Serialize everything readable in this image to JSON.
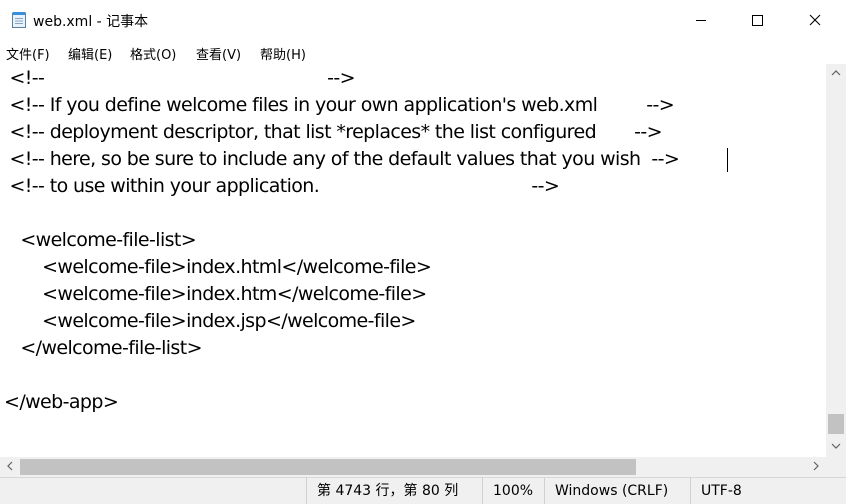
{
  "window": {
    "title": "web.xml - 记事本",
    "app_icon": "notepad-icon",
    "controls": {
      "minimize": "minimize-icon",
      "maximize": "maximize-icon",
      "close": "close-icon"
    }
  },
  "menu": {
    "items": [
      "文件(F)",
      "编辑(E)",
      "格式(O)",
      "查看(V)",
      "帮助(H)"
    ]
  },
  "editor": {
    "lines": [
      " <!--                                                    -->",
      " <!-- If you define welcome files in your own application's web.xml         -->",
      " <!-- deployment descriptor, that list *replaces* the list configured       -->",
      " <!-- here, so be sure to include any of the default values that you wish  -->",
      " <!-- to use within your application.                                       -->",
      "",
      "   <welcome-file-list>",
      "       <welcome-file>index.html</welcome-file>",
      "       <welcome-file>index.htm</welcome-file>",
      "       <welcome-file>index.jsp</welcome-file>",
      "   </welcome-file-list>",
      "",
      "</web-app>"
    ]
  },
  "statusbar": {
    "position": "第 4743 行，第 80 列",
    "zoom": "100%",
    "line_ending": "Windows (CRLF)",
    "encoding": "UTF-8"
  },
  "colors": {
    "chrome_bg": "#f0f0f0",
    "scroll_thumb": "#c2c2c2"
  }
}
